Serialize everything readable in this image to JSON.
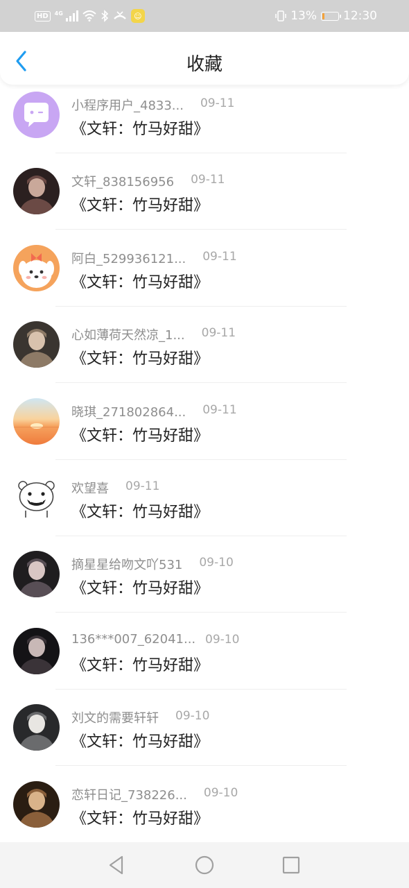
{
  "status_bar": {
    "hd_label": "HD",
    "network_label": "4G",
    "battery_text": "13%",
    "battery_level": 0.13,
    "time": "12:30",
    "icons": [
      "signal-icon",
      "wifi-icon",
      "bluetooth-icon",
      "missed-call-icon",
      "app-notification-icon",
      "vibrate-icon",
      "battery-icon"
    ]
  },
  "header": {
    "title": "收藏"
  },
  "items": [
    {
      "name": "小程序用户_4833...",
      "date": "09-11",
      "message": "《文轩：竹马好甜》",
      "avatar": "chat-bubble-avatar"
    },
    {
      "name": "文轩_838156956",
      "date": "09-11",
      "message": "《文轩：竹马好甜》",
      "avatar": "photo-avatar"
    },
    {
      "name": "阿白_529936121...",
      "date": "09-11",
      "message": "《文轩：竹马好甜》",
      "avatar": "cartoon-dog-avatar"
    },
    {
      "name": "心如薄荷天然凉_1...",
      "date": "09-11",
      "message": "《文轩：竹马好甜》",
      "avatar": "photo-avatar"
    },
    {
      "name": "晓琪_271802864...",
      "date": "09-11",
      "message": "《文轩：竹马好甜》",
      "avatar": "sunset-avatar"
    },
    {
      "name": "欢望喜",
      "date": "09-11",
      "message": "《文轩：竹马好甜》",
      "avatar": "cartoon-bear-avatar"
    },
    {
      "name": "摘星星给吻文吖531",
      "date": "09-10",
      "message": "《文轩：竹马好甜》",
      "avatar": "photo-avatar"
    },
    {
      "name": "136***007_62041...",
      "date": "09-10",
      "message": "《文轩：竹马好甜》",
      "avatar": "photo-avatar"
    },
    {
      "name": "刘文的需要轩轩",
      "date": "09-10",
      "message": "《文轩：竹马好甜》",
      "avatar": "photo-avatar"
    },
    {
      "name": "恋轩日记_738226...",
      "date": "09-10",
      "message": "《文轩：竹马好甜》",
      "avatar": "photo-avatar"
    }
  ],
  "nav_bar": {
    "buttons": [
      "back-triangle-icon",
      "home-circle-icon",
      "recents-square-icon"
    ]
  }
}
